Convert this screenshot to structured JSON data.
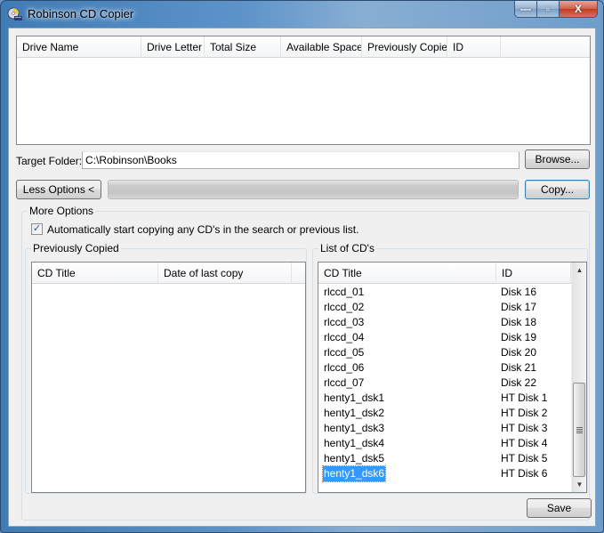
{
  "window": {
    "title": "Robinson CD Copier",
    "controls": {
      "minimize": "—",
      "maximize": "▫",
      "close": "X"
    }
  },
  "drives": {
    "columns": [
      "Drive Name",
      "Drive Letter",
      "Total Size",
      "Available Space",
      "Previously Copied",
      "ID"
    ],
    "rows": []
  },
  "target": {
    "label": "Target Folder:",
    "value": "C:\\Robinson\\Books",
    "browse_label": "Browse..."
  },
  "actions": {
    "less_options_label": "Less Options <",
    "copy_label": "Copy...",
    "progress_percent": 0
  },
  "more_options": {
    "title": "More Options",
    "auto_copy": {
      "label": "Automatically start copying any CD's in the search or previous list.",
      "checked": true
    },
    "previously_copied": {
      "title": "Previously Copied",
      "columns": [
        "CD Title",
        "Date of last copy"
      ],
      "rows": []
    },
    "cd_list": {
      "title": "List of CD's",
      "columns": [
        "CD Title",
        "ID"
      ],
      "rows": [
        {
          "title": "rlccd_01",
          "id": "Disk 16"
        },
        {
          "title": "rlccd_02",
          "id": "Disk 17"
        },
        {
          "title": "rlccd_03",
          "id": "Disk 18"
        },
        {
          "title": "rlccd_04",
          "id": "Disk 19"
        },
        {
          "title": "rlccd_05",
          "id": "Disk 20"
        },
        {
          "title": "rlccd_06",
          "id": "Disk 21"
        },
        {
          "title": "rlccd_07",
          "id": "Disk 22"
        },
        {
          "title": "henty1_dsk1",
          "id": "HT Disk 1"
        },
        {
          "title": "henty1_dsk2",
          "id": "HT Disk 2"
        },
        {
          "title": "henty1_dsk3",
          "id": "HT Disk 3"
        },
        {
          "title": "henty1_dsk4",
          "id": "HT Disk 4"
        },
        {
          "title": "henty1_dsk5",
          "id": "HT Disk 5"
        },
        {
          "title": "henty1_dsk6",
          "id": "HT Disk 6",
          "selected": true
        }
      ],
      "scroll_position": "bottom"
    },
    "save_label": "Save"
  },
  "colors": {
    "selection": "#3399ff",
    "default_button_border": "#3c7fb1",
    "checkmark": "#2a51a0"
  }
}
